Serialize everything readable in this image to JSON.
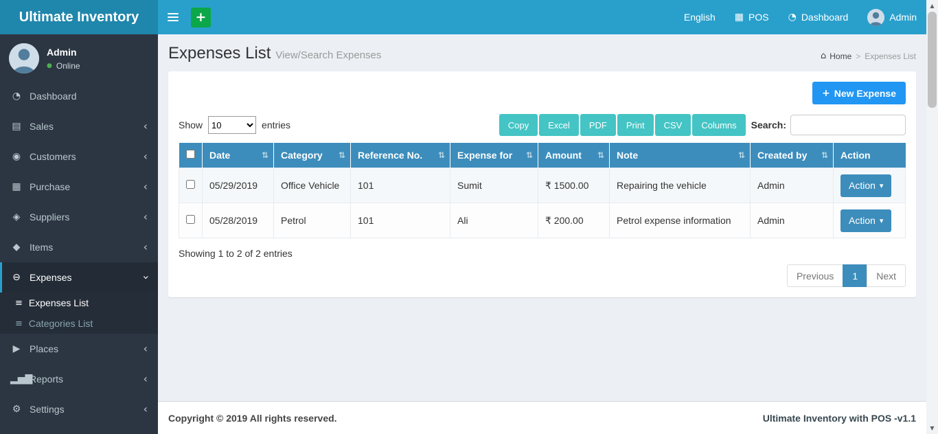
{
  "brand": {
    "title": "Ultimate Inventory"
  },
  "topnav": {
    "language": "English",
    "pos": "POS",
    "dashboard": "Dashboard",
    "user": "Admin"
  },
  "sidebar": {
    "user": {
      "name": "Admin",
      "status": "Online"
    },
    "items": [
      {
        "label": "Dashboard"
      },
      {
        "label": "Sales"
      },
      {
        "label": "Customers"
      },
      {
        "label": "Purchase"
      },
      {
        "label": "Suppliers"
      },
      {
        "label": "Items"
      },
      {
        "label": "Expenses"
      },
      {
        "label": "Places"
      },
      {
        "label": "Reports"
      },
      {
        "label": "Settings"
      }
    ],
    "submenu": [
      {
        "label": "Expenses List"
      },
      {
        "label": "Categories List"
      }
    ]
  },
  "page": {
    "title": "Expenses List",
    "subtitle": "View/Search Expenses",
    "breadcrumb": {
      "home": "Home",
      "current": "Expenses List"
    }
  },
  "toolbar": {
    "new_expense": "New Expense",
    "show_label": "Show",
    "entries_label": "entries",
    "page_size": "10",
    "export_buttons": [
      "Copy",
      "Excel",
      "PDF",
      "Print",
      "CSV",
      "Columns"
    ],
    "search_label": "Search:"
  },
  "table": {
    "columns": [
      "Date",
      "Category",
      "Reference No.",
      "Expense for",
      "Amount",
      "Note",
      "Created by",
      "Action"
    ],
    "rows": [
      {
        "date": "05/29/2019",
        "category": "Office Vehicle",
        "reference": "101",
        "expense_for": "Sumit",
        "amount": "₹ 1500.00",
        "note": "Repairing the vehicle",
        "created_by": "Admin",
        "action": "Action"
      },
      {
        "date": "05/28/2019",
        "category": "Petrol",
        "reference": "101",
        "expense_for": "Ali",
        "amount": "₹ 200.00",
        "note": "Petrol expense information",
        "created_by": "Admin",
        "action": "Action"
      }
    ],
    "summary": "Showing 1 to 2 of 2 entries"
  },
  "pagination": {
    "previous": "Previous",
    "page": "1",
    "next": "Next"
  },
  "footer": {
    "copyright": "Copyright © 2019 All rights reserved.",
    "version": "Ultimate Inventory with POS -v1.1"
  },
  "icons": {
    "plus": "+",
    "calculator": "▦",
    "speedometer": "◔",
    "home": "⌂",
    "sort": "⇅",
    "caret_down": "▾",
    "chevron_left": "‹",
    "list": "≡",
    "dashboard": "◔",
    "sales": "▤",
    "customers": "◉",
    "purchase": "▦",
    "suppliers": "◈",
    "items": "◆",
    "expenses": "⊖",
    "places": "▶",
    "reports": "▂▅▇",
    "settings": "⚙",
    "online_dot": "●",
    "arrow_up": "▲",
    "arrow_down": "▼",
    "breadcrumb_sep": ">"
  },
  "colors": {
    "navbar": "#29a0cc",
    "logo_bg": "#1f86ac",
    "sidebar": "#2c3642",
    "table_header": "#3c8dbc",
    "export_teal": "#44c4c4",
    "new_expense_blue": "#2196f3",
    "quick_add_green": "#0ba749",
    "online_green": "#4caf50",
    "content_bg": "#ecf0f5"
  }
}
